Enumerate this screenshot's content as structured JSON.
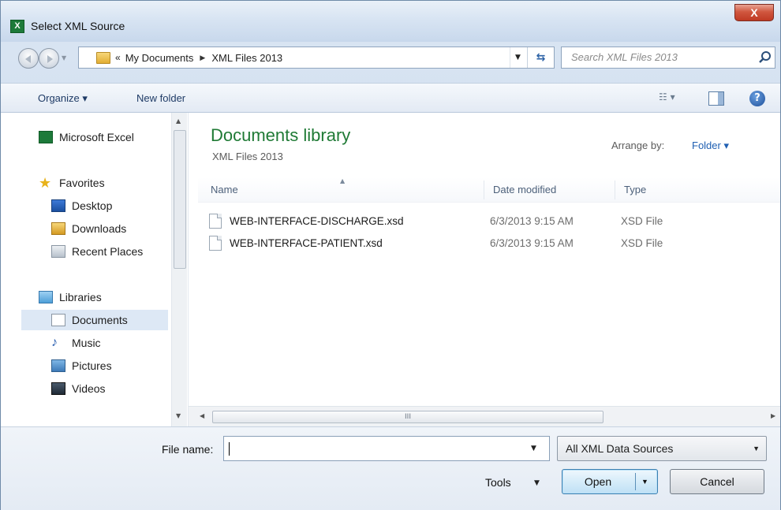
{
  "window": {
    "title": "Select XML Source",
    "close_label": "X",
    "app_icon_label": "X"
  },
  "address": {
    "overflow": "«",
    "crumbs": [
      "My Documents",
      "XML Files 2013"
    ],
    "separator": "▶"
  },
  "search": {
    "placeholder": "Search XML Files 2013"
  },
  "toolbar": {
    "organize": "Organize ▾",
    "new_folder": "New folder"
  },
  "nav": {
    "items": [
      {
        "label": "Microsoft Excel",
        "icon": "excel-icon"
      },
      {
        "label": "Favorites",
        "icon": "star-icon"
      },
      {
        "label": "Desktop",
        "icon": "desktop-icon"
      },
      {
        "label": "Downloads",
        "icon": "downloads-icon"
      },
      {
        "label": "Recent Places",
        "icon": "recent-places-icon"
      },
      {
        "label": "Libraries",
        "icon": "libraries-icon"
      },
      {
        "label": "Documents",
        "icon": "documents-icon",
        "selected": true
      },
      {
        "label": "Music",
        "icon": "music-icon"
      },
      {
        "label": "Pictures",
        "icon": "pictures-icon"
      },
      {
        "label": "Videos",
        "icon": "videos-icon"
      }
    ]
  },
  "library": {
    "title": "Documents library",
    "subtitle": "XML Files 2013",
    "arrange_label": "Arrange by:",
    "arrange_value": "Folder ▾"
  },
  "columns": {
    "name": "Name",
    "date": "Date modified",
    "type": "Type"
  },
  "files": [
    {
      "name": "WEB-INTERFACE-DISCHARGE.xsd",
      "date": "6/3/2013 9:15 AM",
      "type": "XSD File"
    },
    {
      "name": "WEB-INTERFACE-PATIENT.xsd",
      "date": "6/3/2013 9:15 AM",
      "type": "XSD File"
    }
  ],
  "bottom": {
    "file_name_label": "File name:",
    "file_name_value": "",
    "filter_value": "All XML Data Sources",
    "tools_label": "Tools",
    "open_label": "Open",
    "cancel_label": "Cancel"
  },
  "scrollbar": {
    "grip": "III"
  },
  "colors": {
    "library_title": "#1f7a35",
    "link_blue": "#1f5fb2",
    "selection": "#dde8f5"
  }
}
